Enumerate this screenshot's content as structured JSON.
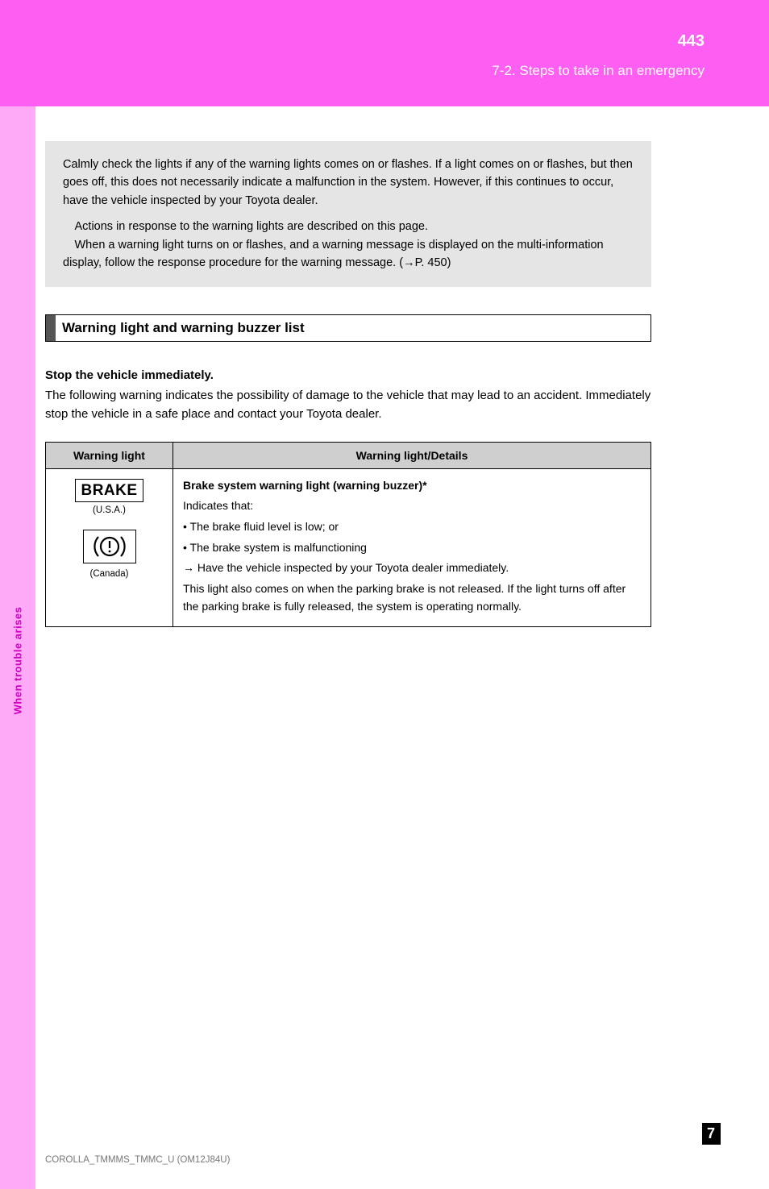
{
  "header": {
    "pageNumber": "443",
    "breadcrumb": "7-2. Steps to take in an emergency"
  },
  "sidebar": {
    "label": "When trouble arises"
  },
  "intro": {
    "p1": "Calmly check the lights if any of the warning lights comes on or flashes. If a light comes on or flashes, but then goes off, this does not necessarily indicate a malfunction in the system. However, if this continues to occur, have the vehicle inspected by your Toyota dealer.",
    "p2": "Actions in response to the warning lights are described on this page.",
    "p3": "When a warning light turns on or flashes, and a warning message is displayed on the multi-information display, follow the response procedure for the warning message. (→P. 450)"
  },
  "tableHeading": "Warning light and warning buzzer list",
  "stopMsg": {
    "line1": "Stop the vehicle immediately.",
    "line2": "The following warning indicates the possibility of damage to the vehicle that may lead to an accident. Immediately stop the vehicle in a safe place and contact your Toyota dealer."
  },
  "table": {
    "headCol1": "Warning light",
    "headCol2": "Warning light/Details",
    "row1": {
      "iconBrakeText": "BRAKE",
      "iconCaption1": "(U.S.A.)",
      "iconCaption2": "(Canada)",
      "title": "Brake system warning light (warning buzzer)*",
      "desc": "Indicates that:",
      "b1": "• The brake fluid level is low; or",
      "b2": "• The brake system is malfunctioning",
      "action": "Have the vehicle inspected by your Toyota dealer immediately.",
      "extra": "This light also comes on when the parking brake is not released. If the light turns off after the parking brake is fully released, the system is operating normally."
    }
  },
  "sideNum": "7",
  "model": "COROLLA_TMMMS_TMMC_U (OM12J84U)"
}
